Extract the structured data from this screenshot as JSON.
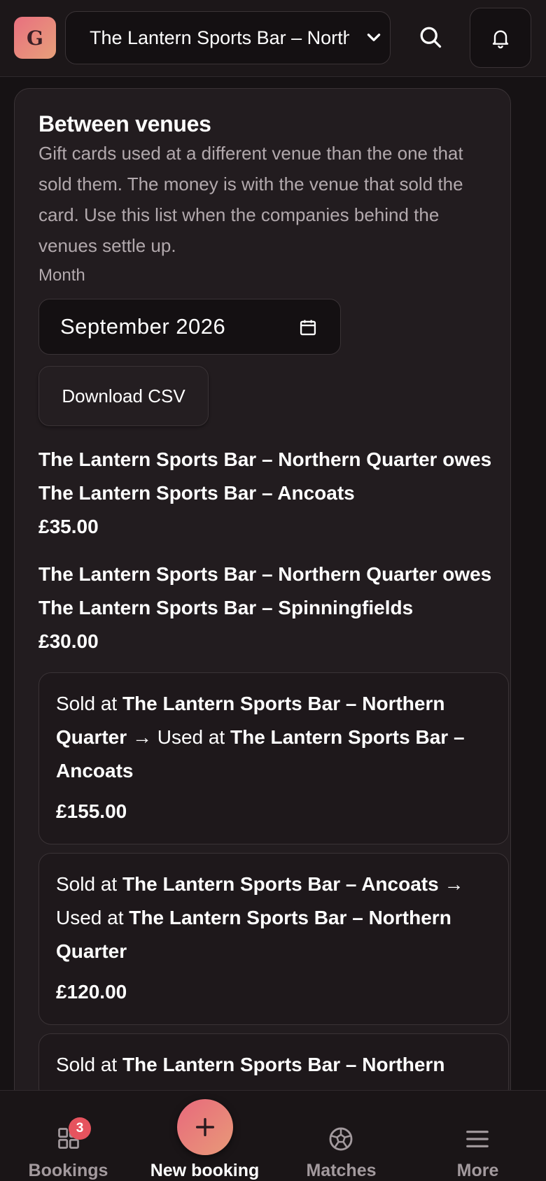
{
  "header": {
    "logo_letter": "G",
    "venue_select_value": "The Lantern Sports Bar – Northern Quarter"
  },
  "section": {
    "title": "Between venues",
    "description": "Gift cards used at a different venue than the one that sold them. The money is with the venue that sold the card. Use this list when the companies behind the venues settle up.",
    "month_label": "Month",
    "month_value": "September 2026",
    "download_label": "Download CSV"
  },
  "summary": [
    {
      "debtor": "The Lantern Sports Bar – Northern Quarter",
      "owes_word": "owes",
      "creditor": "The Lantern Sports Bar – Ancoats",
      "amount": "£35.00"
    },
    {
      "debtor": "The Lantern Sports Bar – Northern Quarter",
      "owes_word": "owes",
      "creditor": "The Lantern Sports Bar – Spinningfields",
      "amount": "£30.00"
    }
  ],
  "transactions": [
    {
      "sold_prefix": "Sold at",
      "sold_venue": "The Lantern Sports Bar – Northern Quarter",
      "used_prefix": "→ Used at",
      "used_venue": "The Lantern Sports Bar – Ancoats",
      "amount": "£155.00"
    },
    {
      "sold_prefix": "Sold at",
      "sold_venue": "The Lantern Sports Bar – Ancoats",
      "used_prefix": "→ Used at",
      "used_venue": "The Lantern Sports Bar – Northern Quarter",
      "amount": "£120.00"
    },
    {
      "sold_prefix": "Sold at",
      "sold_venue": "The Lantern Sports Bar – Northern",
      "used_prefix": "",
      "used_venue": "",
      "amount": ""
    }
  ],
  "nav": {
    "bookings": "Bookings",
    "bookings_badge": "3",
    "new_booking": "New booking",
    "matches": "Matches",
    "more": "More"
  },
  "colors": {
    "accent_gradient_start": "#e9697c",
    "accent_gradient_end": "#e79a78",
    "badge": "#e6535e",
    "background": "#161214"
  }
}
